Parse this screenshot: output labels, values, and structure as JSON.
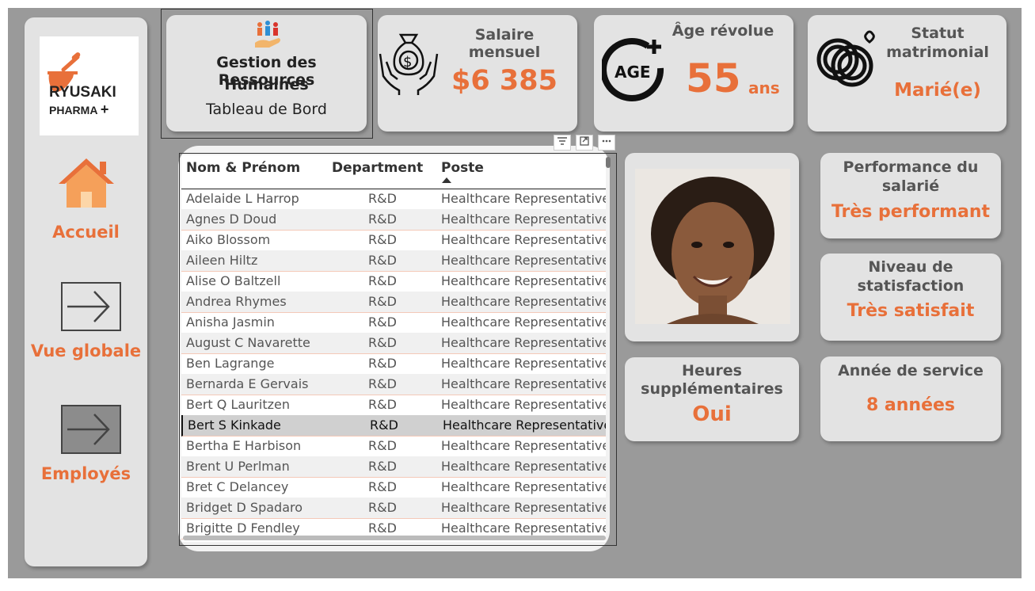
{
  "sidebar": {
    "logo": {
      "line1": "RYUSAKI",
      "line2": "PHARMA",
      "plus": "+"
    },
    "nav": [
      {
        "label": "Accueil",
        "icon": "home-icon"
      },
      {
        "label": "Vue globale",
        "icon": "arrow-right-icon"
      },
      {
        "label": "Employés",
        "icon": "arrow-right-icon"
      }
    ]
  },
  "title_card": {
    "line1": "Gestion des Ressources",
    "line2": "Humaines",
    "subtitle": "Tableau de Bord",
    "icon": "people-group-icon"
  },
  "salary_card": {
    "label": "Salaire mensuel",
    "value": "$6 385",
    "icon": "money-bag-hands-icon"
  },
  "age_card": {
    "label": "Âge révolue",
    "value": "55",
    "unit": "ans",
    "icon": "age-plus-icon",
    "icon_text": "AGE"
  },
  "marital_card": {
    "label_line1": "Statut",
    "label_line2": "matrimonial",
    "value": "Marié(e)",
    "icon": "wedding-rings-icon"
  },
  "table": {
    "headers": [
      "Nom & Prénom",
      "Department",
      "Poste"
    ],
    "sort_icon": "sort-ascending-icon",
    "rows": [
      [
        "Adelaide L Harrop",
        "R&D",
        "Healthcare Representative"
      ],
      [
        "Agnes D Doud",
        "R&D",
        "Healthcare Representative"
      ],
      [
        "Aiko Blossom",
        "R&D",
        "Healthcare Representative"
      ],
      [
        "Aileen Hiltz",
        "R&D",
        "Healthcare Representative"
      ],
      [
        "Alise O Baltzell",
        "R&D",
        "Healthcare Representative"
      ],
      [
        "Andrea Rhymes",
        "R&D",
        "Healthcare Representative"
      ],
      [
        "Anisha Jasmin",
        "R&D",
        "Healthcare Representative"
      ],
      [
        "August C Navarette",
        "R&D",
        "Healthcare Representative"
      ],
      [
        "Ben Lagrange",
        "R&D",
        "Healthcare Representative"
      ],
      [
        "Bernarda E Gervais",
        "R&D",
        "Healthcare Representative"
      ],
      [
        "Bert Q Lauritzen",
        "R&D",
        "Healthcare Representative"
      ],
      [
        "Bert S Kinkade",
        "R&D",
        "Healthcare Representative"
      ],
      [
        "Bertha E Harbison",
        "R&D",
        "Healthcare Representative"
      ],
      [
        "Brent U Perlman",
        "R&D",
        "Healthcare Representative"
      ],
      [
        "Bret C Delancey",
        "R&D",
        "Healthcare Representative"
      ],
      [
        "Bridget D Spadaro",
        "R&D",
        "Healthcare Representative"
      ],
      [
        "Brigitte D Fendley",
        "R&D",
        "Healthcare Representative"
      ]
    ],
    "selected_row": "Bert S Kinkade",
    "toolbar_icons": [
      "filter-icon",
      "focus-mode-icon",
      "more-options-icon"
    ]
  },
  "photo_card": {
    "icon": "employee-photo"
  },
  "performance_card": {
    "label_line1": "Performance du",
    "label_line2": "salarié",
    "value": "Très performant"
  },
  "satisfaction_card": {
    "label_line1": "Niveau de",
    "label_line2": "statisfaction",
    "value": "Très satisfait"
  },
  "overtime_card": {
    "label_line1": "Heures",
    "label_line2": "supplémentaires",
    "value": "Oui"
  },
  "service_card": {
    "label": "Année de service",
    "value": "8 années"
  },
  "colors": {
    "accent": "#e8703a",
    "background": "#9a9a9a",
    "card": "#e3e3e3"
  }
}
